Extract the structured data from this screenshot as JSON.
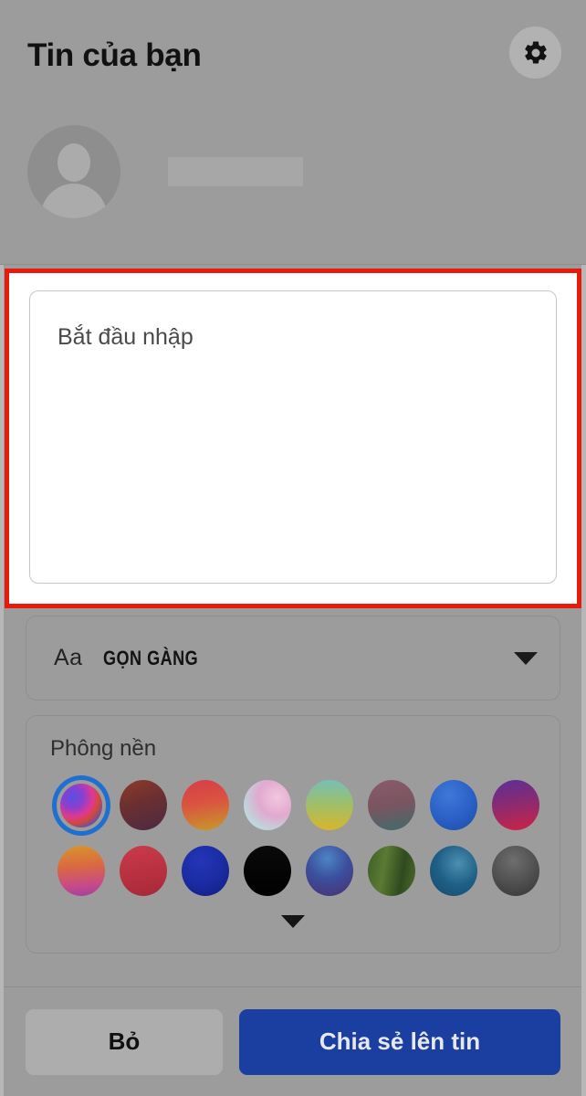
{
  "header": {
    "title": "Tin của bạn",
    "settings_icon": "gear-icon",
    "user": {
      "avatar_icon": "default-avatar-icon",
      "name_redacted": ""
    }
  },
  "composer": {
    "placeholder": "Bắt đầu nhập",
    "value": "",
    "annotation_color": "#e81a0c"
  },
  "font_picker": {
    "aa_label": "Aa",
    "selected_style": "GỌN GÀNG",
    "chevron_icon": "chevron-down-icon"
  },
  "background_panel": {
    "label": "Phông nền",
    "expand_icon": "chevron-down-icon",
    "swatches": [
      {
        "name": "holographic-blue-pink",
        "selected": true,
        "css": "radial-gradient(circle at 30% 30%, #5a4fe0 0%, #8a3fd0 25%, #e0398f 48%, #d3483a 62%, #3f52c9 85%)"
      },
      {
        "name": "dark-maroon",
        "selected": false,
        "css": "linear-gradient(160deg, #8e3a2b 0%, #6b2f31 45%, #4b2a44 100%)"
      },
      {
        "name": "red-orange",
        "selected": false,
        "css": "linear-gradient(170deg, #d73d4a 0%, #da5340 45%, #c79b2a 100%)"
      },
      {
        "name": "pastel-pink-teal",
        "selected": false,
        "css": "radial-gradient(circle at 70% 35%, #f0c8df 0%, #e2a9cf 40%, #bcd9dd 75%, #9fc8d6 100%)"
      },
      {
        "name": "teal-yellow",
        "selected": false,
        "css": "linear-gradient(180deg, #77bfb6 0%, #9bbf6e 45%, #d8b62a 100%)"
      },
      {
        "name": "mauve-teal",
        "selected": false,
        "css": "linear-gradient(170deg, #8a5a6b 0%, #7a5560 50%, #3f6b6b 100%)"
      },
      {
        "name": "royal-blue",
        "selected": false,
        "css": "radial-gradient(circle at 40% 30%, #3f78d8 0%, #2a5fc4 55%, #1e4aa8 100%)"
      },
      {
        "name": "purple-crimson",
        "selected": false,
        "css": "linear-gradient(170deg, #5c2f96 0%, #8e2a6e 50%, #cf2346 100%)"
      },
      {
        "name": "orange-magenta",
        "selected": false,
        "css": "linear-gradient(175deg, #d9962b 0%, #d96a3f 40%, #c94b86 75%, #a23fa0 100%)"
      },
      {
        "name": "crimson-red",
        "selected": false,
        "css": "linear-gradient(170deg, #c93b4c 0%, #b7303f 60%, #a3293a 100%)"
      },
      {
        "name": "deep-blue",
        "selected": false,
        "css": "radial-gradient(circle at 40% 30%, #2436b8 0%, #1a2aa0 55%, #101e7e 100%)"
      },
      {
        "name": "black",
        "selected": false,
        "css": "linear-gradient(180deg, #0a0a0a 0%, #000000 100%)"
      },
      {
        "name": "blue-purple",
        "selected": false,
        "css": "radial-gradient(circle at 45% 25%, #4d84c4 0%, #3b4f9e 45%, #4a2f6e 100%)"
      },
      {
        "name": "forest-green",
        "selected": false,
        "css": "linear-gradient(100deg, #3c5f28 0%, #5b7a33 35%, #2f4a20 70%, #4d6b2c 100%)"
      },
      {
        "name": "teal-blue",
        "selected": false,
        "css": "radial-gradient(circle at 60% 35%, #4b8fb0 0%, #1f5f86 50%, #18496b 100%)"
      },
      {
        "name": "dark-gray",
        "selected": false,
        "css": "radial-gradient(circle at 45% 30%, #6e6e6e 0%, #4e4e4e 55%, #333333 100%)"
      }
    ]
  },
  "footer": {
    "discard_label": "Bỏ",
    "share_label": "Chia sẻ lên tin",
    "share_color": "#1b3fa0"
  }
}
